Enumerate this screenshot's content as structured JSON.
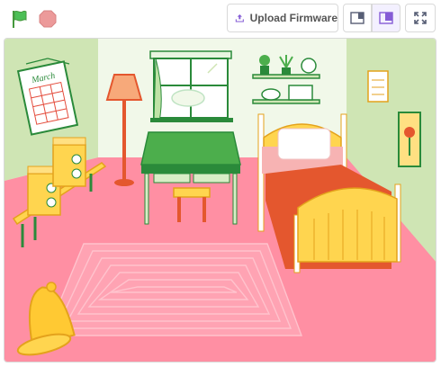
{
  "toolbar": {
    "green_flag_icon": "green-flag-icon",
    "stop_icon": "stop-icon",
    "upload_firmware_label": "Upload Firmware",
    "upload_icon": "upload-icon",
    "small_stage_icon": "small-stage-icon",
    "large_stage_icon": "large-stage-icon",
    "fullscreen_icon": "fullscreen-icon"
  },
  "stage": {
    "calendar_month": "March",
    "backdrop": "bedroom"
  },
  "colors": {
    "flag_green": "#2fae4b",
    "stop_red": "#ec9a9a",
    "accent_purple": "#855cd6",
    "floor_pink": "#ff8fa3",
    "wall_green": "#cfe5b4"
  }
}
